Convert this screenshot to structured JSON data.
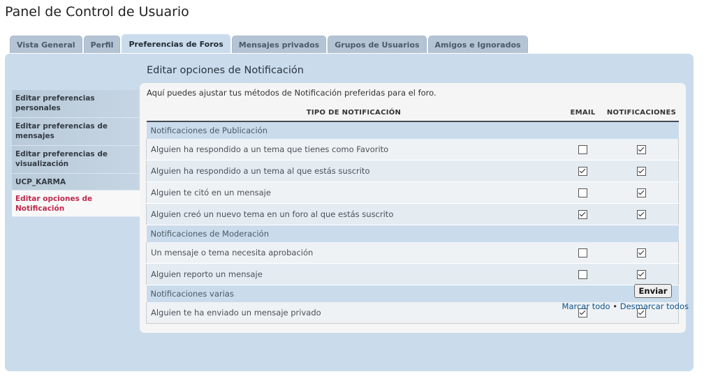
{
  "page": {
    "title": "Panel de Control de Usuario"
  },
  "tabs": [
    {
      "label": "Vista General",
      "active": false
    },
    {
      "label": "Perfil",
      "active": false
    },
    {
      "label": "Preferencias de Foros",
      "active": true
    },
    {
      "label": "Mensajes privados",
      "active": false
    },
    {
      "label": "Grupos de Usuarios",
      "active": false
    },
    {
      "label": "Amigos e Ignorados",
      "active": false
    }
  ],
  "sidebar": {
    "items": [
      {
        "label": "Editar preferencias personales"
      },
      {
        "label": "Editar preferencias de mensajes"
      },
      {
        "label": "Editar preferencias de visualización"
      },
      {
        "label": "UCP_KARMA"
      },
      {
        "label": "Editar opciones de Notificación",
        "active": true
      }
    ]
  },
  "content": {
    "title": "Editar opciones de Notificación",
    "intro": "Aquí puedes ajustar tus métodos de Notificación preferidas para el foro."
  },
  "table": {
    "headers": {
      "type": "TIPO DE NOTIFICACIÓN",
      "email": "EMAIL",
      "notifications": "NOTIFICACIONES"
    },
    "sections": [
      {
        "title": "Notificaciones de Publicación",
        "rows": [
          {
            "label": "Alguien ha respondido a un tema que tienes como Favorito",
            "email": false,
            "notif": true
          },
          {
            "label": "Alguien ha respondido a un tema al que estás suscrito",
            "email": true,
            "notif": true
          },
          {
            "label": "Alguien te citó en un mensaje",
            "email": false,
            "notif": true
          },
          {
            "label": "Alguien creó un nuevo tema en un foro al que estás suscrito",
            "email": true,
            "notif": true
          }
        ]
      },
      {
        "title": "Notificaciones de Moderación",
        "rows": [
          {
            "label": "Un mensaje o tema necesita aprobación",
            "email": false,
            "notif": true
          },
          {
            "label": "Alguien reporto un mensaje",
            "email": false,
            "notif": true
          }
        ]
      },
      {
        "title": "Notificaciones varias",
        "rows": [
          {
            "label": "Alguien te ha enviado un mensaje privado",
            "email": true,
            "notif": true
          }
        ]
      }
    ]
  },
  "actions": {
    "submit_label": "Enviar",
    "mark_all": "Marcar todo",
    "separator": "•",
    "unmark_all": "Desmarcar todos"
  },
  "icons": {
    "checkbox": "checkbox-icon"
  },
  "colors": {
    "link": "#105289",
    "active_side": "#bc2a4d",
    "panel": "#cadceb"
  }
}
